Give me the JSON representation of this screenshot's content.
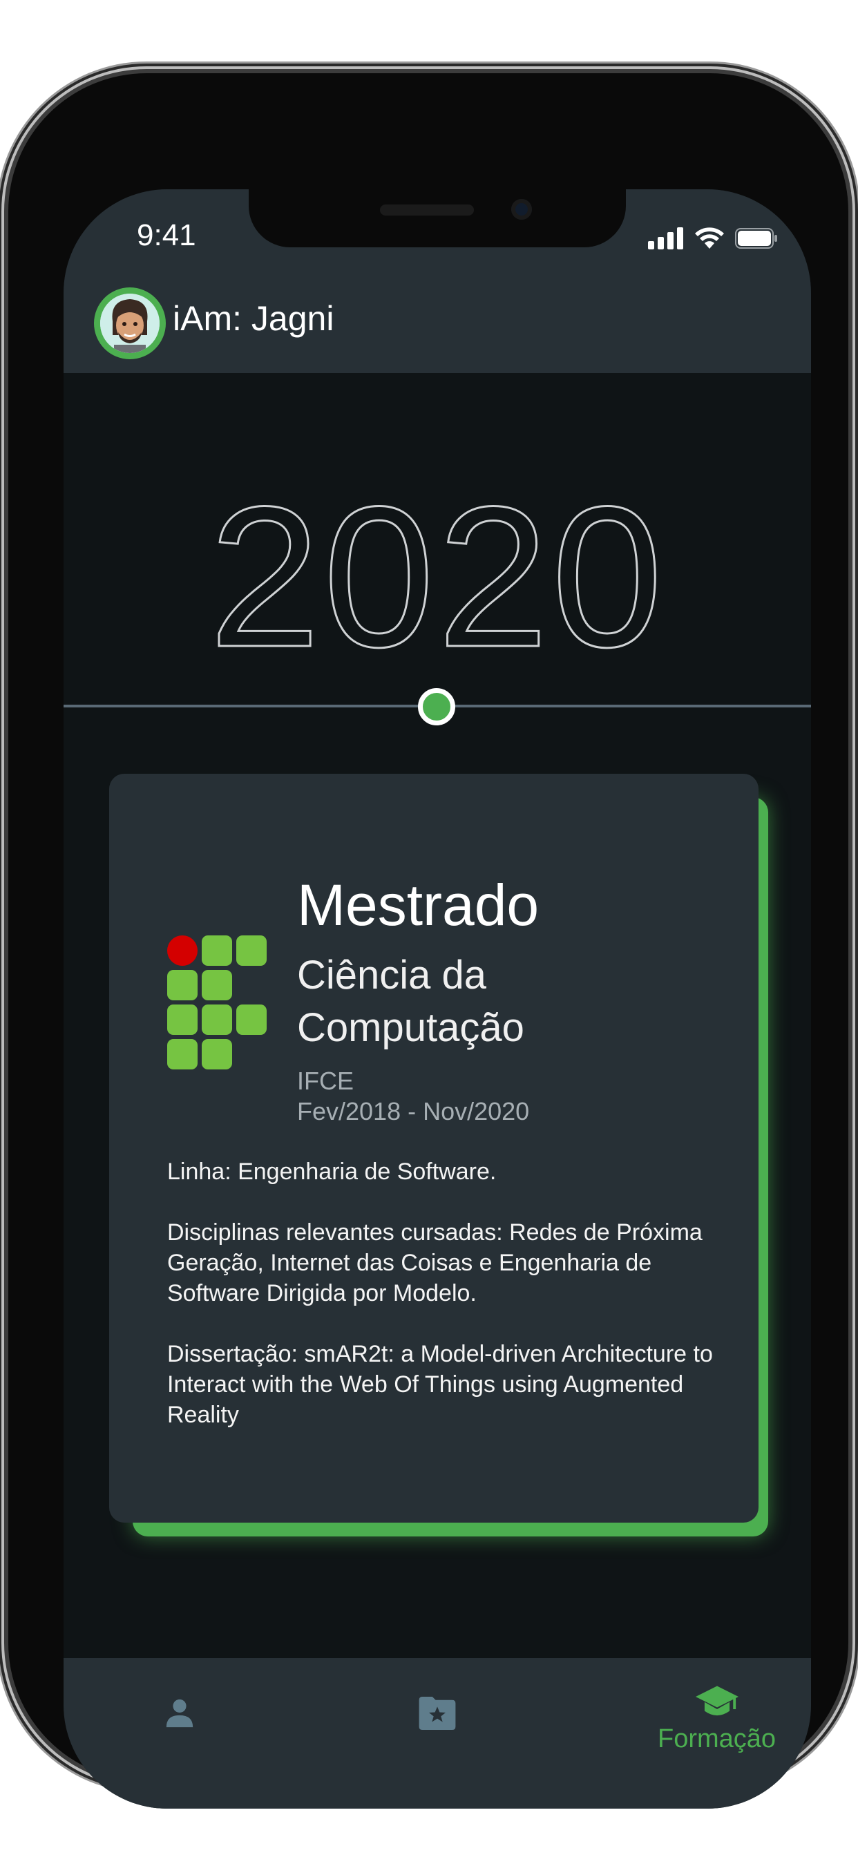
{
  "status_bar": {
    "time": "9:41"
  },
  "app_bar": {
    "title": "iAm: Jagni",
    "avatar_icon": "memoji-avatar"
  },
  "timeline": {
    "year": "2020"
  },
  "card": {
    "degree": "Mestrado",
    "course": "Ciência da Computação",
    "institution": "IFCE",
    "period": "Fev/2018 - Nov/2020",
    "paragraphs": [
      "Linha: Engenharia de Software.",
      "Disciplinas relevantes cursadas: Redes de Próxima Geração, Internet das Coisas e Engenharia de Software Dirigida por Modelo.",
      "Dissertação: smAR2t: a Model-driven Architecture to Interact with the Web Of Things using Augmented Reality"
    ]
  },
  "bottom_nav": {
    "items": [
      {
        "icon": "person-icon",
        "label": "",
        "active": false
      },
      {
        "icon": "folder-star-icon",
        "label": "",
        "active": false
      },
      {
        "icon": "graduation-cap-icon",
        "label": "Formação",
        "active": true
      }
    ]
  },
  "colors": {
    "accent": "#4caf50",
    "surface": "#273036",
    "background": "#0f1416",
    "inactive_icon": "#5f7d8c"
  }
}
